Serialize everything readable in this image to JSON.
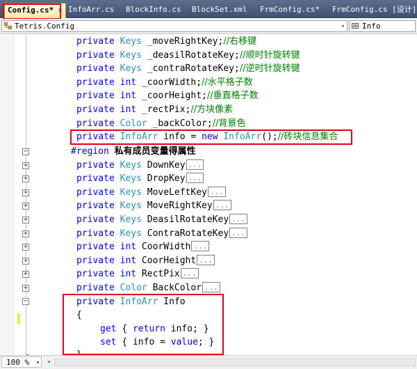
{
  "tabs": [
    {
      "label": "Config.cs*",
      "active": true,
      "close": "×"
    },
    {
      "label": "InfoArr.cs",
      "active": false
    },
    {
      "label": "BlockInfo.cs",
      "active": false
    },
    {
      "label": "BlockSet.xml",
      "active": false
    },
    {
      "label": "FrmConfig.cs*",
      "active": false
    },
    {
      "label": "FrmConfig.cs [设计]*",
      "active": false
    }
  ],
  "nav": {
    "type_combo": "Tetris.Config",
    "member_combo": "Info"
  },
  "code": {
    "l1": {
      "kw": "private",
      "type": "Keys",
      "rest": " _moveRightKey;",
      "comment": "//右移键"
    },
    "l2": {
      "kw": "private",
      "type": "Keys",
      "rest": " _deasilRotateKey;",
      "comment": "//顺时针旋转键"
    },
    "l3": {
      "kw": "private",
      "type": "Keys",
      "rest": " _contraRotateKey;",
      "comment": "//逆时针旋转键"
    },
    "l4": {
      "kw": "private",
      "type": "int",
      "rest": " _coorWidth;",
      "comment": "//水平格子数"
    },
    "l5": {
      "kw": "private",
      "type": "int",
      "rest": " _coorHeight;",
      "comment": "//垂直格子数"
    },
    "l6": {
      "kw": "private",
      "type": "int",
      "rest": " _rectPix;",
      "comment": "//方块像素"
    },
    "l7": {
      "kw": "private",
      "type": "Color",
      "rest": " _backColor;",
      "comment": "//背景色"
    },
    "l8": {
      "kw": "private",
      "type": "InfoArr",
      "rest": " info = ",
      "kw2": "new",
      "type2": "InfoArr",
      "rest2": "();",
      "comment": "//砖块信息集合"
    },
    "region": {
      "kw": "#region",
      "text": "私有成员变量得属性"
    },
    "p1": {
      "kw": "private",
      "type": "Keys",
      "name": " DownKey",
      "ellipsis": "..."
    },
    "p2": {
      "kw": "private",
      "type": "Keys",
      "name": " DropKey",
      "ellipsis": "..."
    },
    "p3": {
      "kw": "private",
      "type": "Keys",
      "name": " MoveLeftKey",
      "ellipsis": "..."
    },
    "p4": {
      "kw": "private",
      "type": "Keys",
      "name": " MoveRightKey",
      "ellipsis": "..."
    },
    "p5": {
      "kw": "private",
      "type": "Keys",
      "name": " DeasilRotateKey",
      "ellipsis": "..."
    },
    "p6": {
      "kw": "private",
      "type": "Keys",
      "name": " ContraRotateKey",
      "ellipsis": "..."
    },
    "p7": {
      "kw": "private",
      "type": "int",
      "name": " CoorWidth",
      "ellipsis": "..."
    },
    "p8": {
      "kw": "private",
      "type": "int",
      "name": " CoorHeight",
      "ellipsis": "..."
    },
    "p9": {
      "kw": "private",
      "type": "int",
      "name": " RectPix",
      "ellipsis": "..."
    },
    "p10": {
      "kw": "private",
      "type": "Color",
      "name": " BackColor",
      "ellipsis": "..."
    },
    "p11": {
      "kw": "private",
      "type": "InfoArr",
      "name": " Info"
    },
    "open_brace": "{",
    "getter": {
      "kw": "get",
      "open": " { ",
      "kw2": "return",
      "rest": " info; }"
    },
    "setter": {
      "kw": "set",
      "open": " { info = ",
      "kw2": "value",
      "rest": "; }"
    },
    "close_brace": "}"
  },
  "fold_signs": {
    "expand": "+",
    "collapse": "−"
  },
  "status": {
    "zoom": "100 %",
    "zoom_arrow": "▾",
    "scroll_left": "◂",
    "drop_arrow": "▾"
  },
  "colors": {
    "keyword": "#0000ff",
    "type": "#2b91af",
    "comment": "#008000",
    "highlight_box": "#e1001a"
  }
}
